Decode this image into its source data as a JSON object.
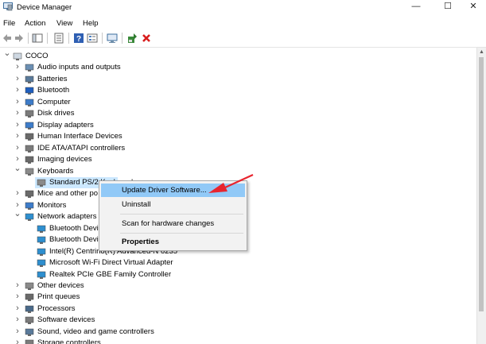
{
  "window": {
    "title": "Device Manager",
    "minimize": "—",
    "maximize": "☐",
    "close": "✕"
  },
  "menu": {
    "file": "File",
    "action": "Action",
    "view": "View",
    "help": "Help"
  },
  "tree": {
    "root": "COCO",
    "categories": [
      "Audio inputs and outputs",
      "Batteries",
      "Bluetooth",
      "Computer",
      "Disk drives",
      "Display adapters",
      "Human Interface Devices",
      "IDE ATA/ATAPI controllers",
      "Imaging devices",
      "Keyboards",
      "Mice and other po",
      "Monitors",
      "Network adapters",
      "Other devices",
      "Print queues",
      "Processors",
      "Software devices",
      "Sound, video and game controllers",
      "Storage controllers"
    ],
    "keyboard_child": "Standard PS/2 Keyboard",
    "network_children": [
      "Bluetooth Devi",
      "Bluetooth Devi",
      "Intel(R) Centrino(R) Advanced-N 6235",
      "Microsoft Wi-Fi Direct Virtual Adapter",
      "Realtek PCIe GBE Family Controller"
    ]
  },
  "context_menu": {
    "update": "Update Driver Software...",
    "uninstall": "Uninstall",
    "scan": "Scan for hardware changes",
    "properties": "Properties"
  },
  "colors": {
    "selection": "#cce8ff",
    "menu_highlight": "#91c9f7",
    "annotation_arrow": "#e8252f"
  }
}
